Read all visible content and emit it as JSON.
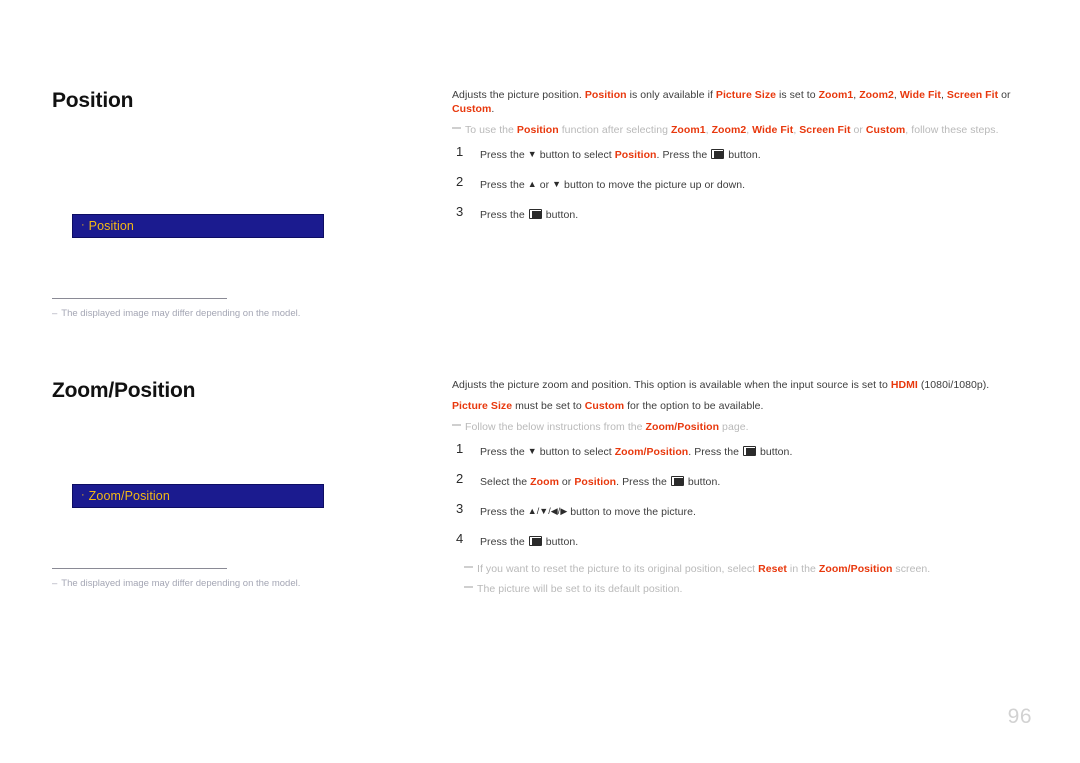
{
  "page": {
    "number": "96",
    "accent_color": "#e8380d",
    "menu_box_bg": "#1b1b8f",
    "menu_box_text_color": "#f3b815",
    "body_text_color": "#3d3d3d",
    "note_text_color": "#b9b9b9",
    "footnote_text_color": "#a4a6b4"
  },
  "sections": [
    {
      "id": "position",
      "heading": "Position",
      "menu_box": {
        "bullet": "·",
        "label": "Position"
      },
      "footnote": {
        "dash": "–",
        "text": "The displayed image may differ depending on the model."
      },
      "intro": {
        "seg1": "Adjusts the picture position. ",
        "hl1": "Position",
        "seg2": " is only available if ",
        "hl2": "Picture Size",
        "seg3": " is set to ",
        "hl3": "Zoom1",
        "seg4": ", ",
        "hl4": "Zoom2",
        "seg5": ", ",
        "hl5": "Wide Fit",
        "seg6": ", ",
        "hl6": "Screen Fit",
        "seg7": " or ",
        "hl7": "Custom",
        "seg8": "."
      },
      "note": {
        "seg1": "To use the ",
        "hl1": "Position",
        "seg2": " function after selecting ",
        "hl2": "Zoom1",
        "seg3": ", ",
        "hl3": "Zoom2",
        "seg4": ", ",
        "hl4": "Wide Fit",
        "seg5": ", ",
        "hl5": "Screen Fit",
        "seg6": " or ",
        "hl6": "Custom",
        "seg7": ", follow these steps."
      },
      "steps": [
        {
          "num": "1",
          "seg1": "Press the ",
          "arrow1": "▼",
          "seg2": " button to select ",
          "hl1": "Position",
          "seg3": ". Press the ",
          "icon": "enter-key-icon",
          "seg4": " button."
        },
        {
          "num": "2",
          "seg1": "Press the ",
          "arrow1": "▲",
          "seg2": " or ",
          "arrow2": "▼",
          "seg3": " button to move the picture up or down."
        },
        {
          "num": "3",
          "seg1": "Press the ",
          "icon": "enter-key-icon",
          "seg2": " button."
        }
      ]
    },
    {
      "id": "zoomposition",
      "heading": "Zoom/Position",
      "menu_box": {
        "bullet": "·",
        "label": "Zoom/Position"
      },
      "footnote": {
        "dash": "–",
        "text": "The displayed image may differ depending on the model."
      },
      "intro1": {
        "seg1": "Adjusts the picture zoom and position. This option is available when the input source is set to ",
        "hl1": "HDMI",
        "seg2": " (1080i/1080p)."
      },
      "intro2": {
        "hl1": "Picture Size",
        "seg1": " must be set to ",
        "hl2": "Custom",
        "seg2": " for the option to be available."
      },
      "note": {
        "seg1": "Follow the below instructions from the ",
        "hl1": "Zoom/Position",
        "seg2": " page."
      },
      "steps": [
        {
          "num": "1",
          "seg1": "Press the ",
          "arrow1": "▼",
          "seg2": " button to select ",
          "hl1": "Zoom/Position",
          "seg3": ". Press the ",
          "icon": "enter-key-icon",
          "seg4": " button."
        },
        {
          "num": "2",
          "seg1": "Select the ",
          "hl1": "Zoom",
          "seg2": " or ",
          "hl2": "Position",
          "seg3": ". Press the ",
          "icon": "enter-key-icon",
          "seg4": " button."
        },
        {
          "num": "3",
          "seg1": "Press the ",
          "arrows": "▲/▼/◀/▶",
          "seg2": " button to move the picture."
        },
        {
          "num": "4",
          "seg1": "Press the ",
          "icon": "enter-key-icon",
          "seg2": " button."
        }
      ],
      "tail_notes": [
        {
          "seg1": "If you want to reset the picture to its original position, select ",
          "hl1": "Reset",
          "seg2": " in the ",
          "hl2": "Zoom/Position",
          "seg3": " screen."
        },
        {
          "seg1": "The picture will be set to its default position."
        }
      ]
    }
  ]
}
